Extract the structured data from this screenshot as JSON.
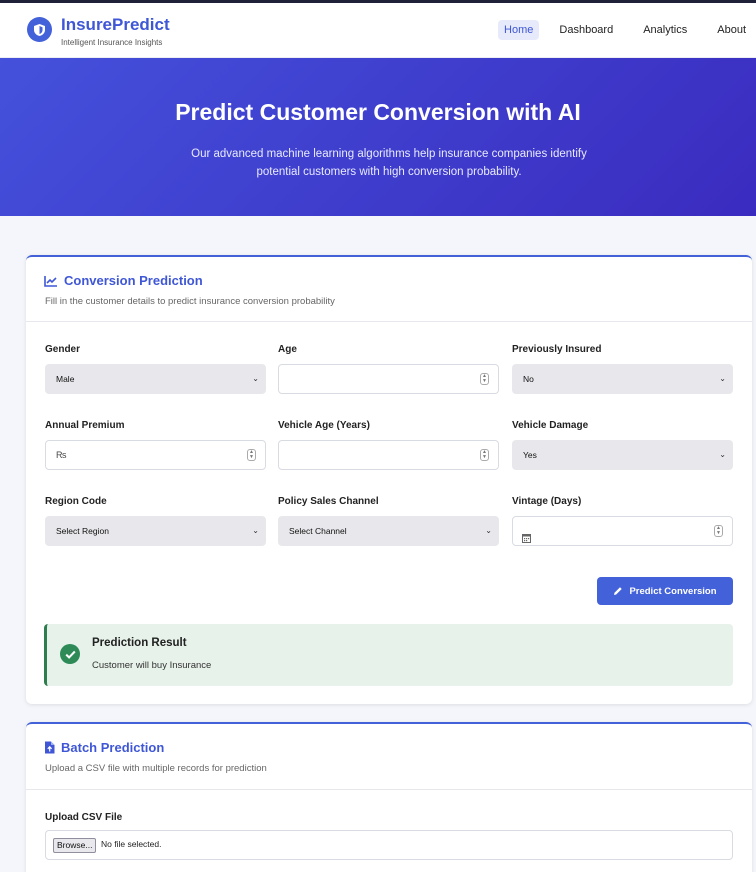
{
  "brand": {
    "name": "InsurePredict",
    "tagline": "Intelligent Insurance Insights"
  },
  "nav": [
    {
      "label": "Home",
      "active": true
    },
    {
      "label": "Dashboard",
      "active": false
    },
    {
      "label": "Analytics",
      "active": false
    },
    {
      "label": "About",
      "active": false
    }
  ],
  "hero": {
    "title": "Predict Customer Conversion with AI",
    "subtitle": "Our advanced machine learning algorithms help insurance companies identify potential customers with high conversion probability."
  },
  "prediction_card": {
    "title": "Conversion Prediction",
    "description": "Fill in the customer details to predict insurance conversion probability",
    "fields": {
      "gender": {
        "label": "Gender",
        "value": "Male"
      },
      "age": {
        "label": "Age",
        "value": ""
      },
      "previously_insured": {
        "label": "Previously Insured",
        "value": "No"
      },
      "annual_premium": {
        "label": "Annual Premium",
        "value": "₨"
      },
      "vehicle_age": {
        "label": "Vehicle Age (Years)",
        "value": ""
      },
      "vehicle_damage": {
        "label": "Vehicle Damage",
        "value": "Yes"
      },
      "region_code": {
        "label": "Region Code",
        "value": "Select Region"
      },
      "policy_sales_channel": {
        "label": "Policy Sales Channel",
        "value": "Select Channel"
      },
      "vintage": {
        "label": "Vintage (Days)",
        "value": ""
      }
    },
    "predict_button": "Predict Conversion",
    "result": {
      "title": "Prediction Result",
      "text": "Customer will buy Insurance"
    }
  },
  "batch_card": {
    "title": "Batch Prediction",
    "description": "Upload a CSV file with multiple records for prediction",
    "upload_label": "Upload CSV File",
    "browse_label": "Browse...",
    "file_status": "No file selected."
  },
  "colors": {
    "accent": "#4361d8",
    "success": "#2e8b57",
    "hero_start": "#4451db",
    "hero_end": "#3a2bbf"
  }
}
